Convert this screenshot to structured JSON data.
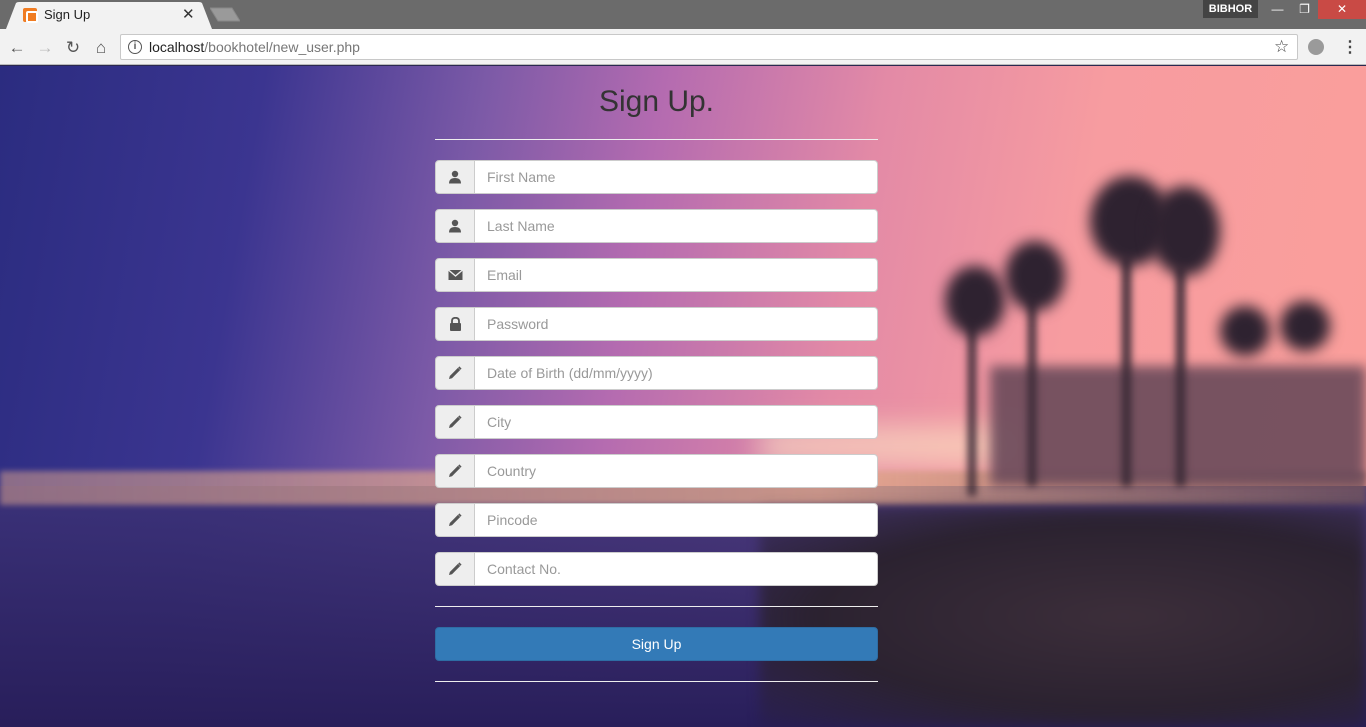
{
  "browser": {
    "tab_title": "Sign Up",
    "url_host": "localhost",
    "url_path": "/bookhotel/new_user.php",
    "profile_name": "BIBHOR",
    "icons": [
      "back-icon",
      "forward-icon",
      "reload-icon",
      "home-icon",
      "info-icon",
      "star-icon",
      "menu-icon"
    ]
  },
  "page": {
    "title": "Sign Up.",
    "fields": [
      {
        "icon": "user-icon",
        "placeholder": "First Name"
      },
      {
        "icon": "user-icon",
        "placeholder": "Last Name"
      },
      {
        "icon": "envelope-icon",
        "placeholder": "Email"
      },
      {
        "icon": "lock-icon",
        "placeholder": "Password"
      },
      {
        "icon": "pencil-icon",
        "placeholder": "Date of Birth (dd/mm/yyyy)"
      },
      {
        "icon": "pencil-icon",
        "placeholder": "City"
      },
      {
        "icon": "pencil-icon",
        "placeholder": "Country"
      },
      {
        "icon": "pencil-icon",
        "placeholder": "Pincode"
      },
      {
        "icon": "pencil-icon",
        "placeholder": "Contact No."
      }
    ],
    "submit_label": "Sign Up",
    "colors": {
      "primary": "#337ab7",
      "addon_bg": "#eeeeee"
    }
  }
}
